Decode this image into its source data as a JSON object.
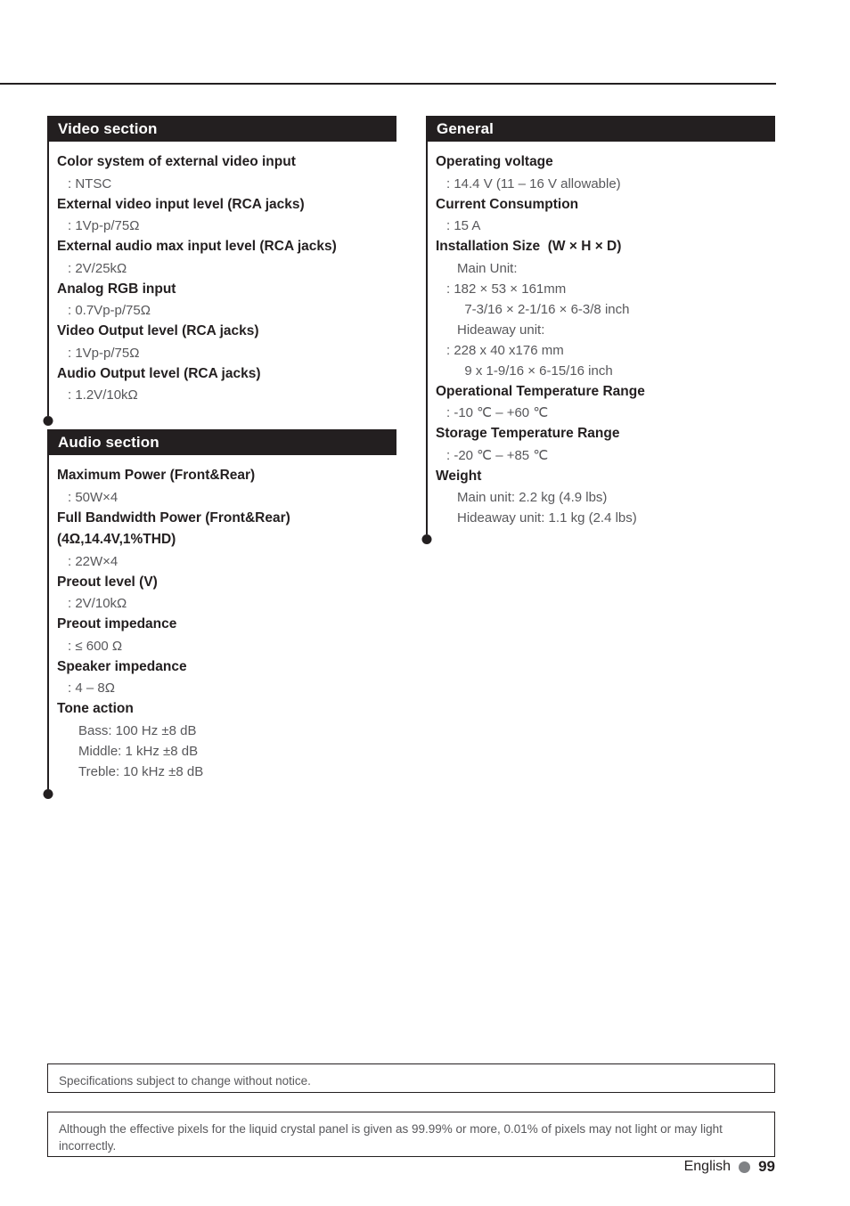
{
  "page": {
    "language_label": "English",
    "page_number": "99"
  },
  "sections": [
    {
      "id": "video-section",
      "title": "Video section",
      "entries": [
        {
          "label": "Color system of external video input",
          "values": [
            ": NTSC"
          ]
        },
        {
          "label": "External video input level (RCA jacks)",
          "values": [
            ": 1Vp-p/75Ω"
          ]
        },
        {
          "label": "External audio max input level (RCA jacks)",
          "values": [
            ": 2V/25kΩ"
          ]
        },
        {
          "label": "Analog RGB input",
          "values": [
            ": 0.7Vp-p/75Ω"
          ]
        },
        {
          "label": "Video Output level (RCA jacks)",
          "values": [
            ": 1Vp-p/75Ω"
          ]
        },
        {
          "label": "Audio Output level (RCA jacks)",
          "values": [
            ": 1.2V/10kΩ"
          ]
        }
      ]
    },
    {
      "id": "audio-section",
      "title": "Audio section",
      "entries": [
        {
          "label": "Maximum Power (Front&Rear)",
          "values": [
            ": 50W×4"
          ]
        },
        {
          "label": "Full Bandwidth Power (Front&Rear)\n(4Ω,14.4V,1%THD)",
          "values": [
            ": 22W×4"
          ]
        },
        {
          "label": "Preout level (V)",
          "values": [
            ": 2V/10kΩ"
          ]
        },
        {
          "label": "Preout impedance",
          "values": [
            ": ≤ 600 Ω"
          ]
        },
        {
          "label": "Speaker impedance",
          "values": [
            ": 4 – 8Ω"
          ]
        },
        {
          "label": "Tone action",
          "values": [
            "Bass: 100 Hz ±8 dB",
            "Middle: 1 kHz ±8 dB",
            "Treble: 10 kHz ±8 dB"
          ]
        }
      ]
    },
    {
      "id": "general-section",
      "title": "General",
      "entries": [
        {
          "label": "Operating voltage",
          "values": [
            ": 14.4 V (11 – 16 V allowable)"
          ]
        },
        {
          "label": "Current Consumption",
          "values": [
            ": 15 A"
          ]
        },
        {
          "label": "Installation Size  (W × H × D)",
          "values": [
            "Main Unit:",
            ": 182 × 53 × 161mm",
            "  7-3/16 × 2-1/16 × 6-3/8 inch",
            "Hideaway unit:",
            ": 228 x 40 x176 mm",
            "  9 x 1-9/16 × 6-15/16 inch"
          ]
        },
        {
          "label": "Operational Temperature Range",
          "values": [
            ": -10 ℃ – +60 ℃"
          ]
        },
        {
          "label": "Storage Temperature Range",
          "values": [
            ": -20 ℃ – +85 ℃"
          ]
        },
        {
          "label": "Weight",
          "values": [
            "Main unit: 2.2 kg (4.9 lbs)",
            "Hideaway unit: 1.1 kg (2.4 lbs)"
          ]
        }
      ]
    }
  ],
  "notices": [
    "Specifications subject to change without notice.",
    "Although the effective pixels for the liquid crystal panel is given as 99.99% or more, 0.01% of pixels may not light or may light incorrectly."
  ]
}
